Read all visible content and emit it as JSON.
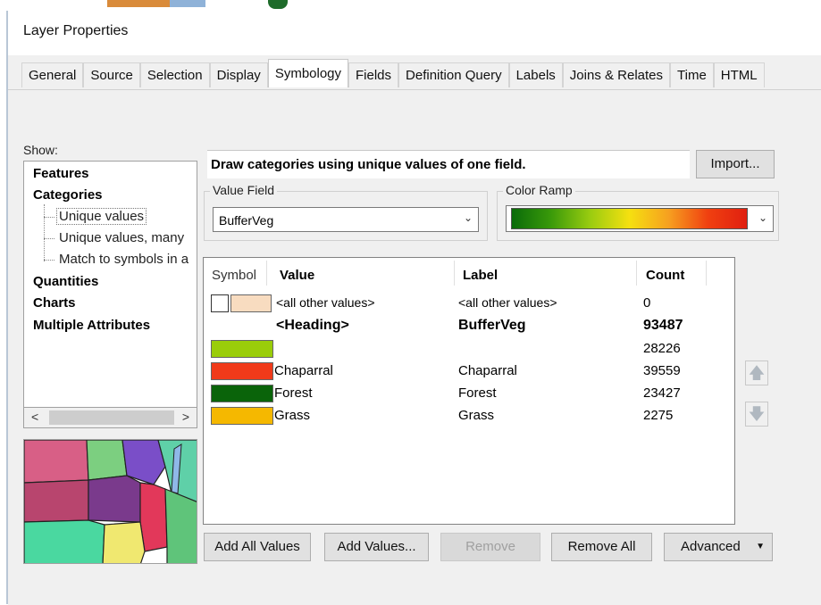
{
  "window": {
    "title": "Layer Properties"
  },
  "tabs": [
    {
      "label": "General"
    },
    {
      "label": "Source"
    },
    {
      "label": "Selection"
    },
    {
      "label": "Display"
    },
    {
      "label": "Symbology",
      "active": true
    },
    {
      "label": "Fields"
    },
    {
      "label": "Definition Query"
    },
    {
      "label": "Labels"
    },
    {
      "label": "Joins & Relates"
    },
    {
      "label": "Time"
    },
    {
      "label": "HTML"
    }
  ],
  "show": {
    "label": "Show:",
    "items": [
      {
        "label": "Features"
      },
      {
        "label": "Categories"
      },
      {
        "label": "Unique values"
      },
      {
        "label": "Unique values, many"
      },
      {
        "label": "Match to symbols in a"
      },
      {
        "label": "Quantities"
      },
      {
        "label": "Charts"
      },
      {
        "label": "Multiple Attributes"
      }
    ]
  },
  "description": "Draw categories using unique values of one field.",
  "import_label": "Import...",
  "value_field": {
    "label": "Value Field",
    "value": "BufferVeg"
  },
  "color_ramp": {
    "label": "Color Ramp"
  },
  "table": {
    "headers": {
      "symbol": "Symbol",
      "value": "Value",
      "label": "Label",
      "count": "Count"
    },
    "rows": [
      {
        "value": "<all other values>",
        "label": "<all other values>",
        "count": "0",
        "color": "#f8dcc0"
      },
      {
        "value": "<Heading>",
        "label": "BufferVeg",
        "count": "93487"
      },
      {
        "value": "",
        "label": "",
        "count": "28226",
        "color": "#9acd0a"
      },
      {
        "value": "Chaparral",
        "label": "Chaparral",
        "count": "39559",
        "color": "#f03a1a"
      },
      {
        "value": "Forest",
        "label": "Forest",
        "count": "23427",
        "color": "#0a640a"
      },
      {
        "value": "Grass",
        "label": "Grass",
        "count": "2275",
        "color": "#f5b800"
      }
    ]
  },
  "buttons": {
    "add_all": "Add All Values",
    "add_values": "Add Values...",
    "remove": "Remove",
    "remove_all": "Remove All",
    "advanced": "Advanced"
  }
}
